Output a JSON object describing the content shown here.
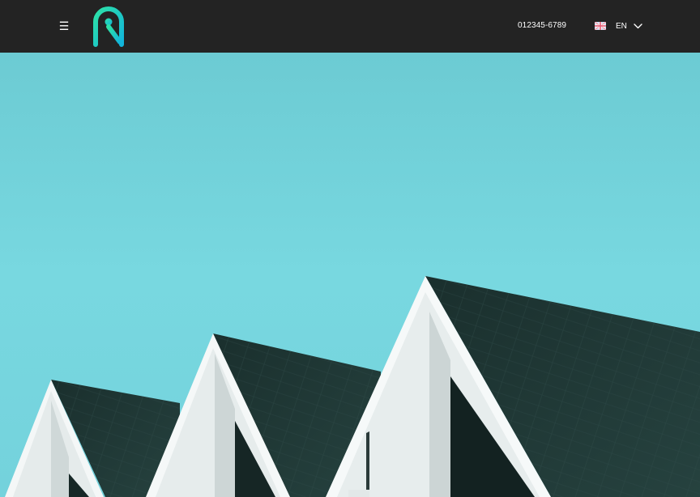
{
  "header": {
    "menu_icon": "hamburger-icon",
    "logo_icon": "brand-logo-icon",
    "phone": "012345-6789",
    "language": {
      "flag_icon": "uk-flag-icon",
      "label": "EN",
      "chevron_icon": "chevron-down-icon"
    }
  },
  "hero": {
    "image": "rooftops-photo"
  },
  "colors": {
    "header_bg": "#232323",
    "sky": "#74d3dc",
    "roof": "#1f3a37",
    "wall": "#e6ecec",
    "logo_start": "#2de1a6",
    "logo_end": "#18b7d8"
  }
}
